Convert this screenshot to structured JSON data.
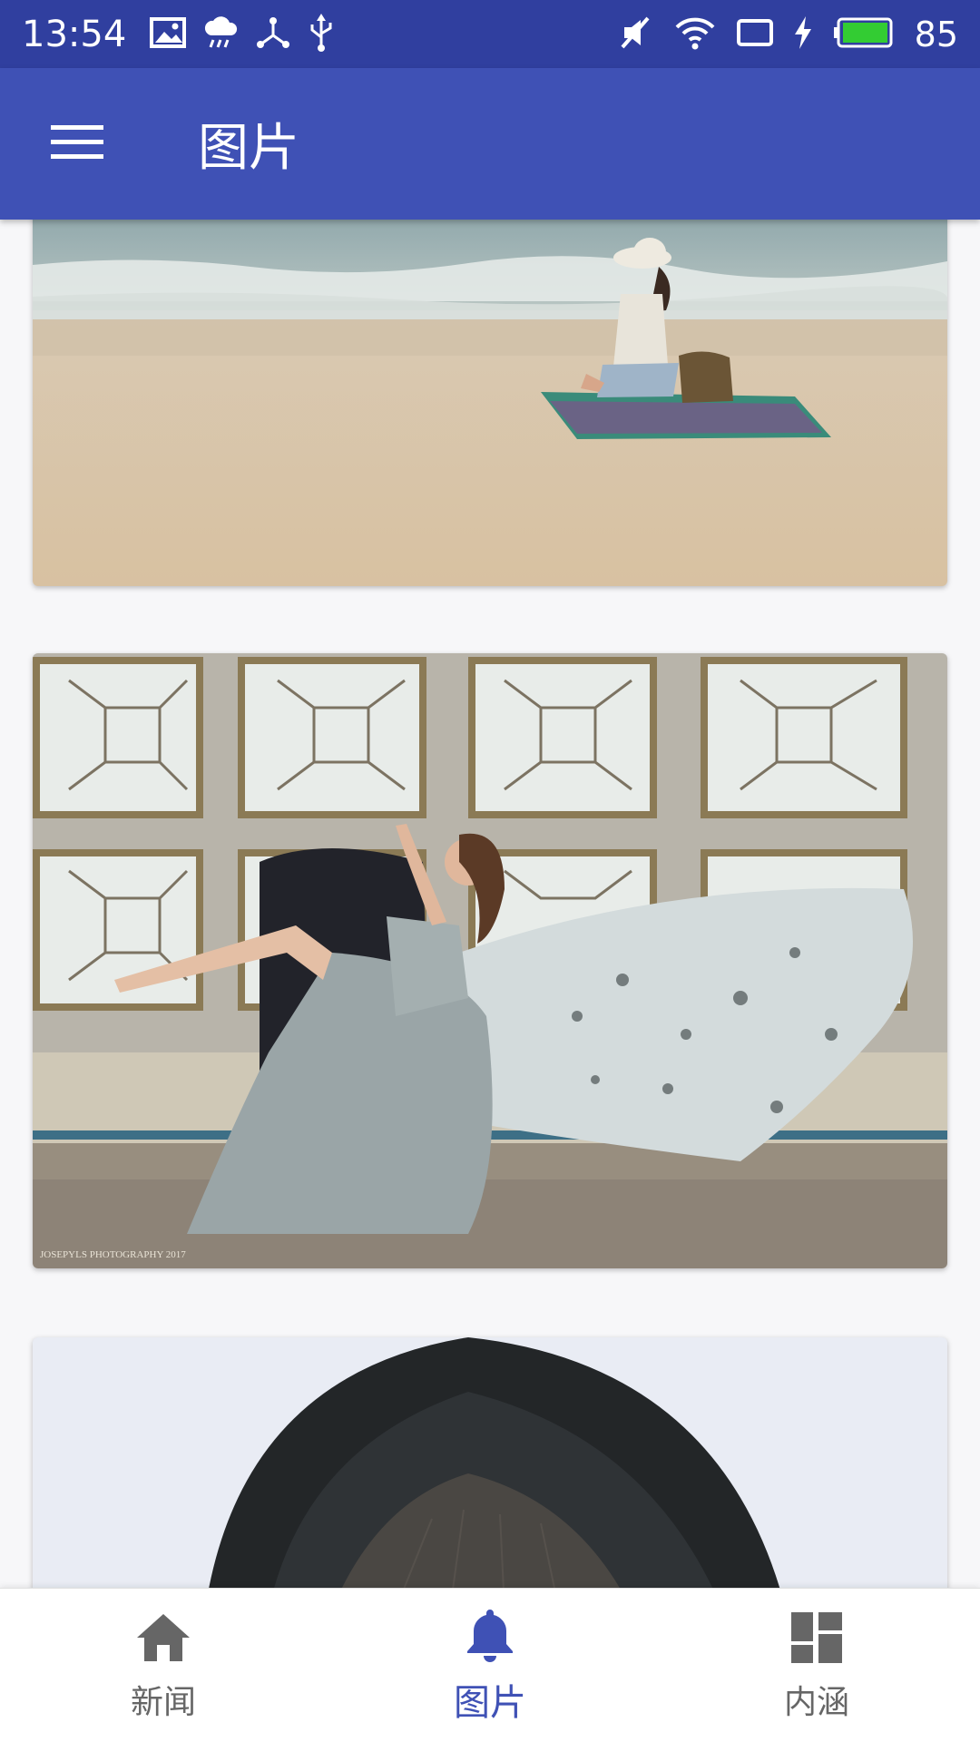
{
  "status_bar": {
    "time": "13:54",
    "battery_percent": "85",
    "left_icons": [
      "image-icon",
      "weather-icon",
      "share-nodes-icon",
      "usb-icon"
    ],
    "right_icons": [
      "mute-icon",
      "wifi-icon",
      "screen-icon",
      "charging-icon",
      "battery-icon"
    ]
  },
  "app_bar": {
    "title": "图片",
    "menu_icon": "menu-icon"
  },
  "feed": {
    "items": [
      {
        "name": "beach-photo"
      },
      {
        "name": "gown-window-photo",
        "watermark": "JOSEPYLS PHOTOGRAPHY 2017"
      },
      {
        "name": "hair-closeup-photo"
      }
    ]
  },
  "bottom_nav": {
    "items": [
      {
        "label": "新闻",
        "icon": "home-icon",
        "active": false
      },
      {
        "label": "图片",
        "icon": "bell-icon",
        "active": true
      },
      {
        "label": "内涵",
        "icon": "dashboard-icon",
        "active": false
      }
    ],
    "active_color": "#3f51b5",
    "inactive_color": "#666666"
  },
  "colors": {
    "status_bar": "#303f9f",
    "app_bar": "#3f51b5",
    "background": "#f7f7f9"
  }
}
